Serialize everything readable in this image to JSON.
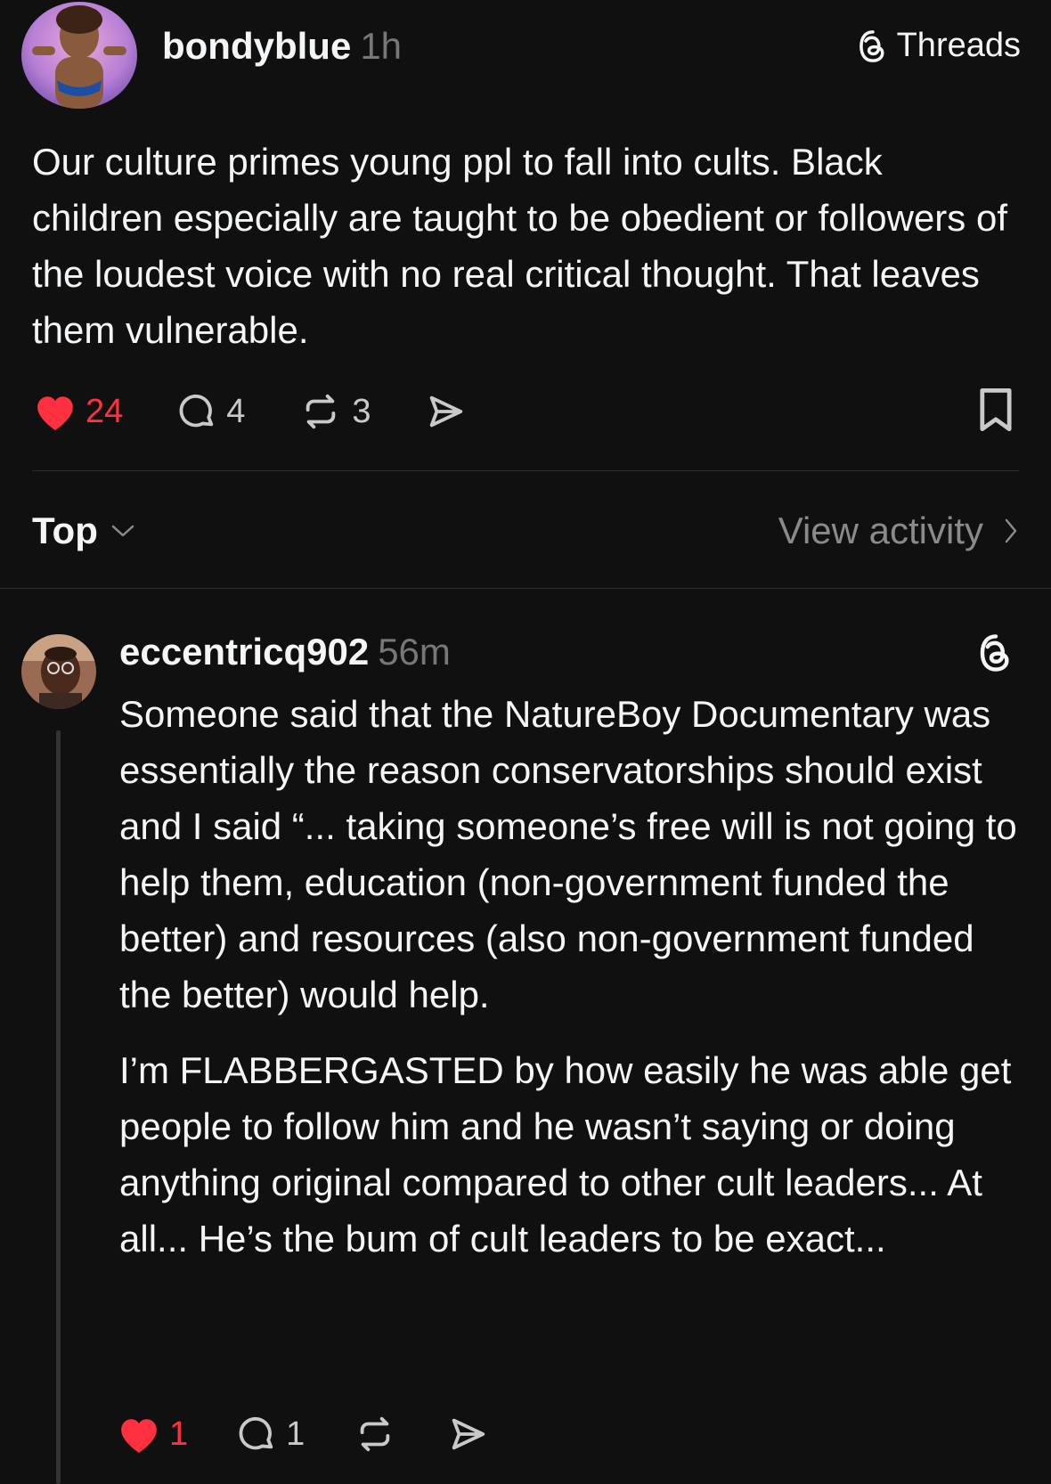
{
  "post": {
    "username": "bondyblue",
    "time": "1h",
    "badge_label": "Threads",
    "text": "Our culture primes young ppl to fall into cults. Black children especially are taught to be obedient or followers of the loudest voice with no real critical thought. That leaves them vulnerable.",
    "likes": "24",
    "comments": "4",
    "reposts": "3"
  },
  "sort": {
    "label": "Top",
    "view_activity": "View activity"
  },
  "reply": {
    "username": "eccentricq902",
    "time": "56m",
    "paragraph1": "Someone said that the NatureBoy Documentary was essentially the reason conservatorships should exist and I said “... taking someone’s free will is not going to help them, education (non-government funded the better) and resources (also non-government funded the better) would help.",
    "paragraph2": "I’m FLABBERGASTED by how easily he was able get people to follow him and he wasn’t saying or doing anything original compared to other cult leaders... At all... He’s the bum of cult leaders to be exact...",
    "likes": "1",
    "comments": "1"
  },
  "colors": {
    "background": "#101010",
    "text": "#f3f5f7",
    "muted": "#777777",
    "like_red": "#ff3040"
  },
  "icons": [
    "heart-icon",
    "comment-icon",
    "repost-icon",
    "share-icon",
    "bookmark-icon",
    "threads-logo-icon",
    "chevron-down-icon",
    "chevron-right-icon"
  ]
}
